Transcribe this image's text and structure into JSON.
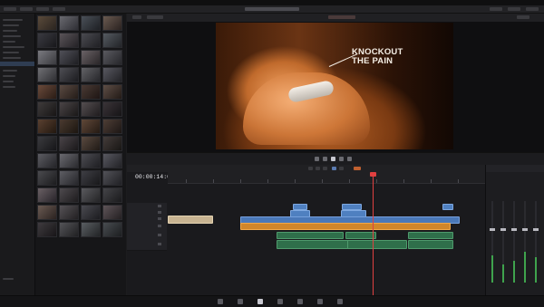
{
  "viewer": {
    "overlay_title": "KNOCKOUT\nTHE PAIN"
  },
  "timeline": {
    "timecode": "00:00:14:04"
  },
  "colors": {
    "video_clip": "#4a78b8",
    "title_clip": "#d1862a",
    "audio_clip": "#2f6f4a",
    "playhead": "#e04040",
    "selection": "#2f3d52"
  },
  "icons": [
    "play-icon",
    "stop-icon",
    "loop-icon",
    "snap-icon",
    "razor-icon",
    "edit-page-icon",
    "media-page-icon",
    "cut-page-icon",
    "fusion-page-icon",
    "color-page-icon",
    "fairlight-page-icon",
    "deliver-page-icon"
  ]
}
